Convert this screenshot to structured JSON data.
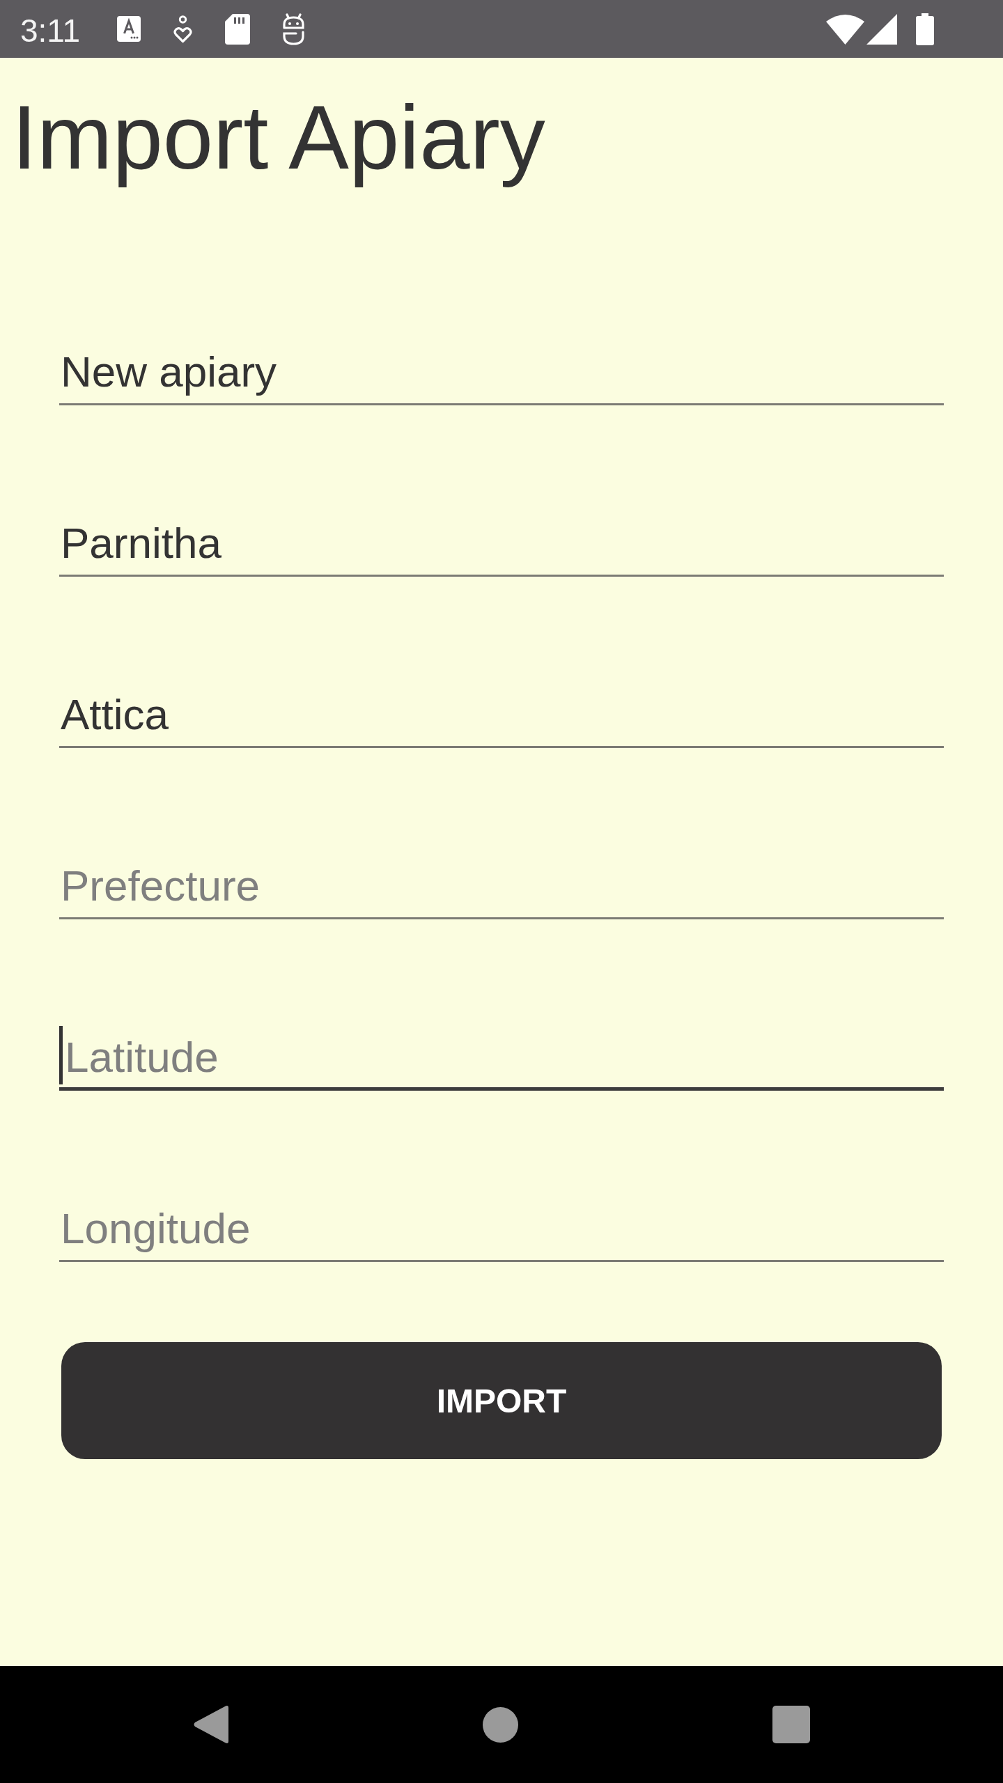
{
  "status_bar": {
    "time": "3:11"
  },
  "title": "Import Apiary",
  "fields": [
    {
      "value": "New apiary",
      "focused": false
    },
    {
      "value": "Parnitha",
      "focused": false
    },
    {
      "value": "Attica",
      "focused": false
    },
    {
      "placeholder": "Prefecture",
      "focused": false
    },
    {
      "placeholder": "Latitude",
      "focused": true
    },
    {
      "placeholder": "Longitude",
      "focused": false
    }
  ],
  "button": {
    "label": "IMPORT"
  }
}
